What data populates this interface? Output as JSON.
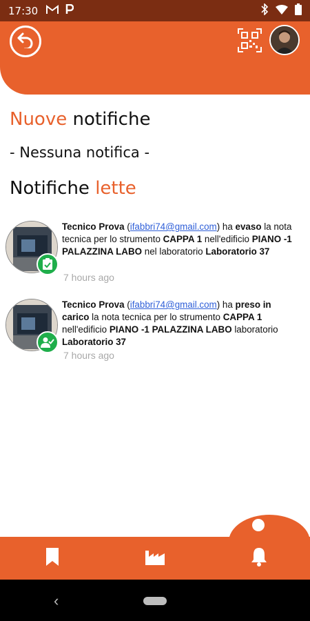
{
  "status_bar": {
    "time": "17:30",
    "left_icons": [
      "gmail-icon",
      "parking-icon"
    ],
    "right_icons": [
      "bluetooth-icon",
      "wifi-icon",
      "battery-icon"
    ]
  },
  "header": {
    "back_icon": "back-arrow-icon",
    "qr_icon": "qr-code-icon",
    "avatar": "user-avatar"
  },
  "sections": {
    "new": {
      "accent": "Nuove",
      "rest": " notifiche"
    },
    "empty_message": "- Nessuna notifica -",
    "read": {
      "rest": "Notifiche ",
      "accent": "lette"
    }
  },
  "notifications": [
    {
      "user": "Tecnico Prova",
      "email": "ifabbri74@gmail.com",
      "p1": " ha ",
      "action": "evaso",
      "p2": " la nota tecnica per lo strumento ",
      "instrument": "CAPPA 1",
      "p3": " nell'edificio ",
      "building": "PIANO -1 PALAZZINA LABO",
      "p4": " nel laboratorio ",
      "lab": "Laboratorio 37",
      "time": "7 hours ago",
      "badge_icon": "clipboard-check-icon"
    },
    {
      "user": "Tecnico Prova",
      "email": "ifabbri74@gmail.com",
      "p1": " ha ",
      "action": "preso in carico",
      "p2": " la nota tecnica per lo strumento ",
      "instrument": "CAPPA 1",
      "p3": " nell'edificio ",
      "building": "PIANO -1 PALAZZINA LABO",
      "p4": " laboratorio ",
      "lab": "Laboratorio 37",
      "time": "7 hours ago",
      "badge_icon": "user-check-icon"
    }
  ],
  "bottom_nav": {
    "items": [
      "bookmark-icon",
      "factory-icon",
      "bell-icon"
    ],
    "active": "bell-icon"
  },
  "colors": {
    "accent": "#e8612c",
    "status_bar": "#7b2d12",
    "badge": "#1fae4b",
    "link": "#2f5fd8"
  }
}
